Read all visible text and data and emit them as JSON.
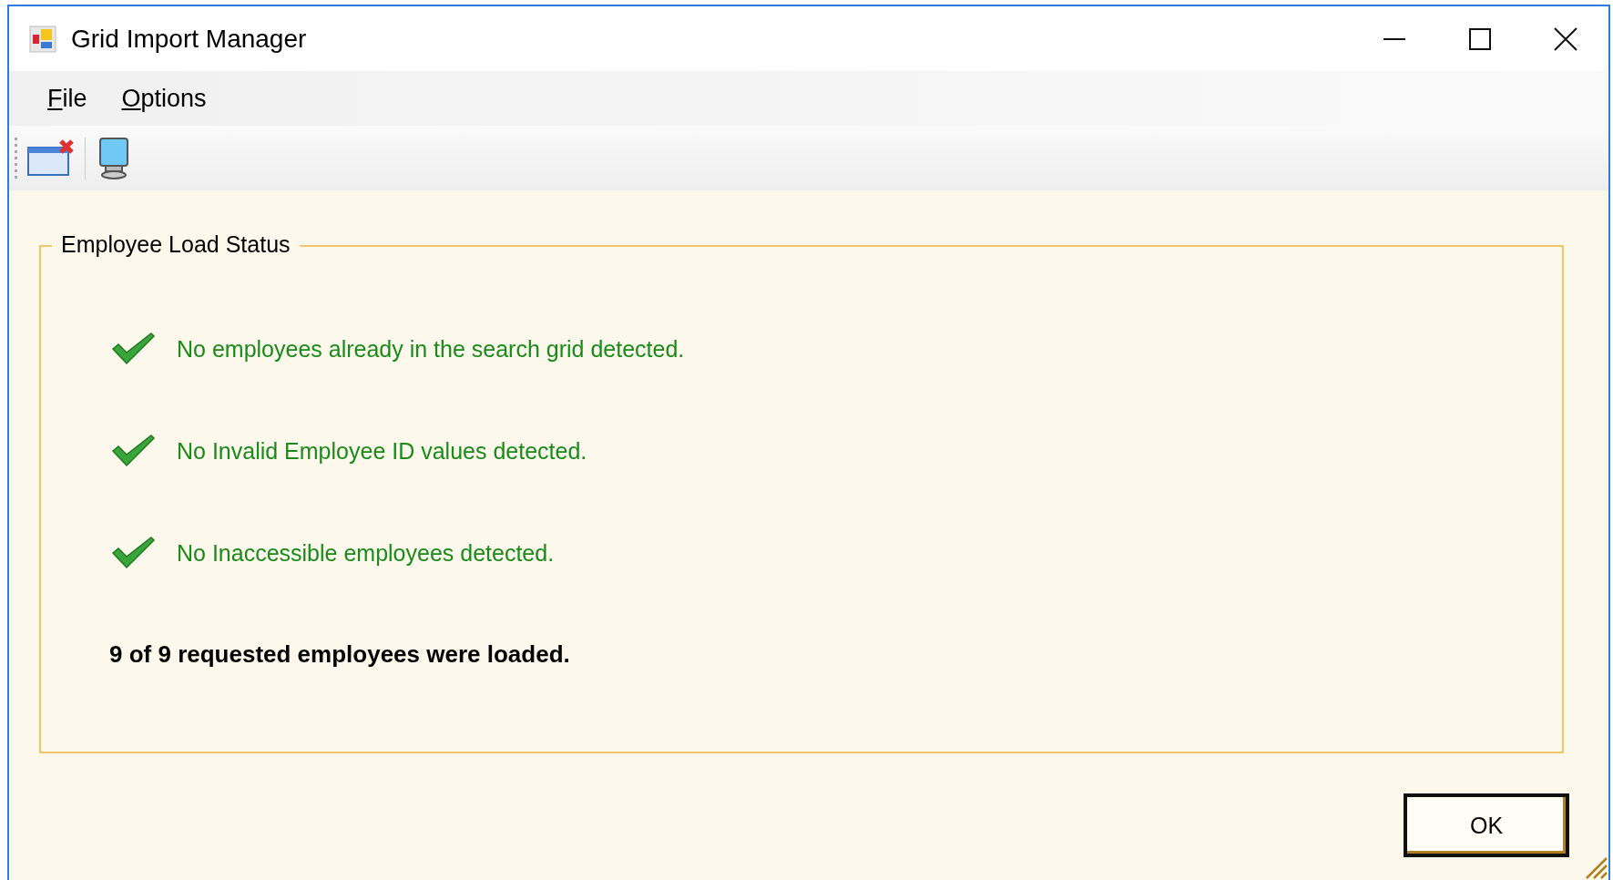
{
  "window": {
    "title": "Grid Import Manager"
  },
  "menu": [
    {
      "label": "File",
      "mnemonic_underlined": true
    },
    {
      "label": "Options",
      "mnemonic_underlined": true
    }
  ],
  "toolbar": [
    {
      "kind": "close-window"
    },
    {
      "kind": "separator"
    },
    {
      "kind": "computer"
    }
  ],
  "group": {
    "title": "Employee Load Status",
    "checks": [
      {
        "text": "No employees already in the search grid detected.",
        "passed": true
      },
      {
        "text": "No Invalid Employee ID values detected.",
        "passed": true
      },
      {
        "text": "No Inaccessible employees detected.",
        "passed": true
      }
    ],
    "summary": "9 of 9 requested employees were loaded."
  },
  "buttons": [
    {
      "label": "OK",
      "default": true
    }
  ]
}
